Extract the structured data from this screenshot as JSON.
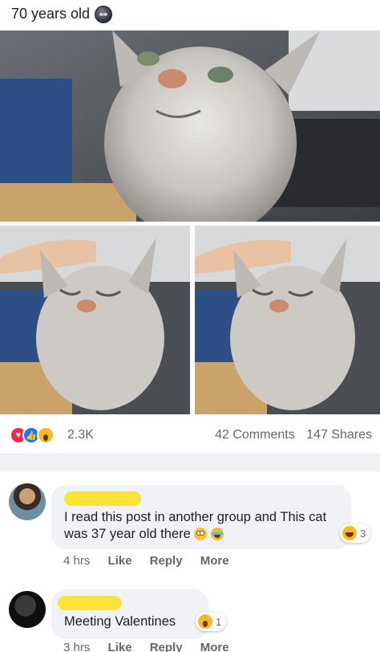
{
  "post": {
    "title": "70 years old",
    "title_emoji": "dark-face-emoji"
  },
  "photos": [
    {
      "name": "cat-photo-main"
    },
    {
      "name": "cat-photo-left"
    },
    {
      "name": "cat-photo-right"
    }
  ],
  "stats": {
    "reaction_icons": [
      "love-reaction-icon",
      "like-reaction-icon",
      "wow-reaction-icon"
    ],
    "reaction_count": "2.3K",
    "comments": "42 Comments",
    "shares": "147 Shares"
  },
  "comments": [
    {
      "text": "I read this post in another group and This cat was 37 year old there",
      "inline_emojis": [
        "eye-roll-emoji",
        "tears-of-joy-emoji"
      ],
      "reaction_icon": "haha-reaction-icon",
      "reaction_count": "3",
      "time": "4 hrs",
      "like": "Like",
      "reply": "Reply",
      "more": "More"
    },
    {
      "text": "Meeting Valentines",
      "reaction_icon": "wow-reaction-icon",
      "reaction_count": "1",
      "time": "3 hrs",
      "like": "Like",
      "reply": "Reply",
      "more": "More"
    }
  ],
  "colors": {
    "love": "#f0284a",
    "like": "#1877f2",
    "wow": "#f7b928",
    "bubble": "#f0f2f5",
    "meta_text": "#65676b",
    "redaction": "#fbe43a"
  }
}
